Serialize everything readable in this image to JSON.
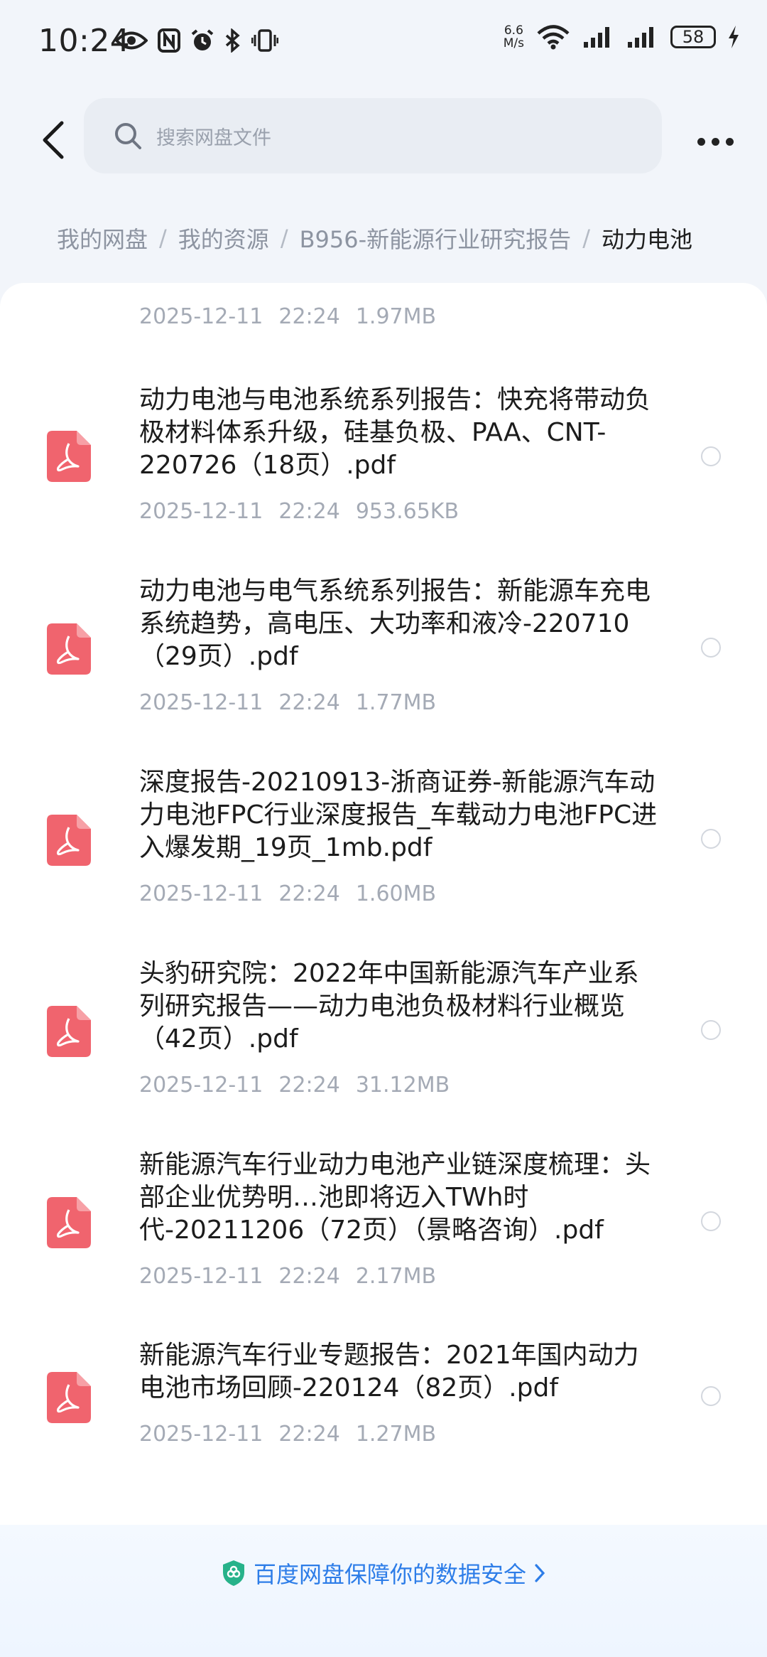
{
  "status_bar": {
    "time": "10:24",
    "net_speed_value": "6.6",
    "net_speed_unit": "M/s",
    "battery": "58",
    "icons": [
      "eye-icon",
      "nfc-icon",
      "alarm-icon",
      "bluetooth-icon",
      "vibrate-icon",
      "wifi-icon",
      "signal-icon",
      "charging-icon"
    ]
  },
  "header": {
    "search_placeholder": "搜索网盘文件"
  },
  "breadcrumb": [
    "我的网盘",
    "我的资源",
    "B956-新能源行业研究报告",
    "动力电池"
  ],
  "files": [
    {
      "name": "",
      "date": "2025-12-11",
      "time": "22:24",
      "size": "1.97MB"
    },
    {
      "name": "动力电池与电池系统系列报告：快充将带动负极材料体系升级，硅基负极、PAA、CNT-220726（18页）.pdf",
      "date": "2025-12-11",
      "time": "22:24",
      "size": "953.65KB"
    },
    {
      "name": "动力电池与电气系统系列报告：新能源车充电系统趋势，高电压、大功率和液冷-220710（29页）.pdf",
      "date": "2025-12-11",
      "time": "22:24",
      "size": "1.77MB"
    },
    {
      "name": "深度报告-20210913-浙商证券-新能源汽车动力电池FPC行业深度报告_车载动力电池FPC进入爆发期_19页_1mb.pdf",
      "date": "2025-12-11",
      "time": "22:24",
      "size": "1.60MB"
    },
    {
      "name": "头豹研究院：2022年中国新能源汽车产业系列研究报告——动力电池负极材料行业概览（42页）.pdf",
      "date": "2025-12-11",
      "time": "22:24",
      "size": "31.12MB"
    },
    {
      "name": "新能源汽车行业动力电池产业链深度梳理：头部企业优势明…池即将迈入TWh时代-20211206（72页）（景略咨询）.pdf",
      "date": "2025-12-11",
      "time": "22:24",
      "size": "2.17MB"
    },
    {
      "name": "新能源汽车行业专题报告：2021年国内动力电池市场回顾-220124（82页）.pdf",
      "date": "2025-12-11",
      "time": "22:24",
      "size": "1.27MB"
    }
  ],
  "footer": {
    "text": "百度网盘保障你的数据安全"
  },
  "colors": {
    "pdf_icon": "#f0646e",
    "accent": "#2d7de8",
    "meta_text": "#a4aab5"
  }
}
